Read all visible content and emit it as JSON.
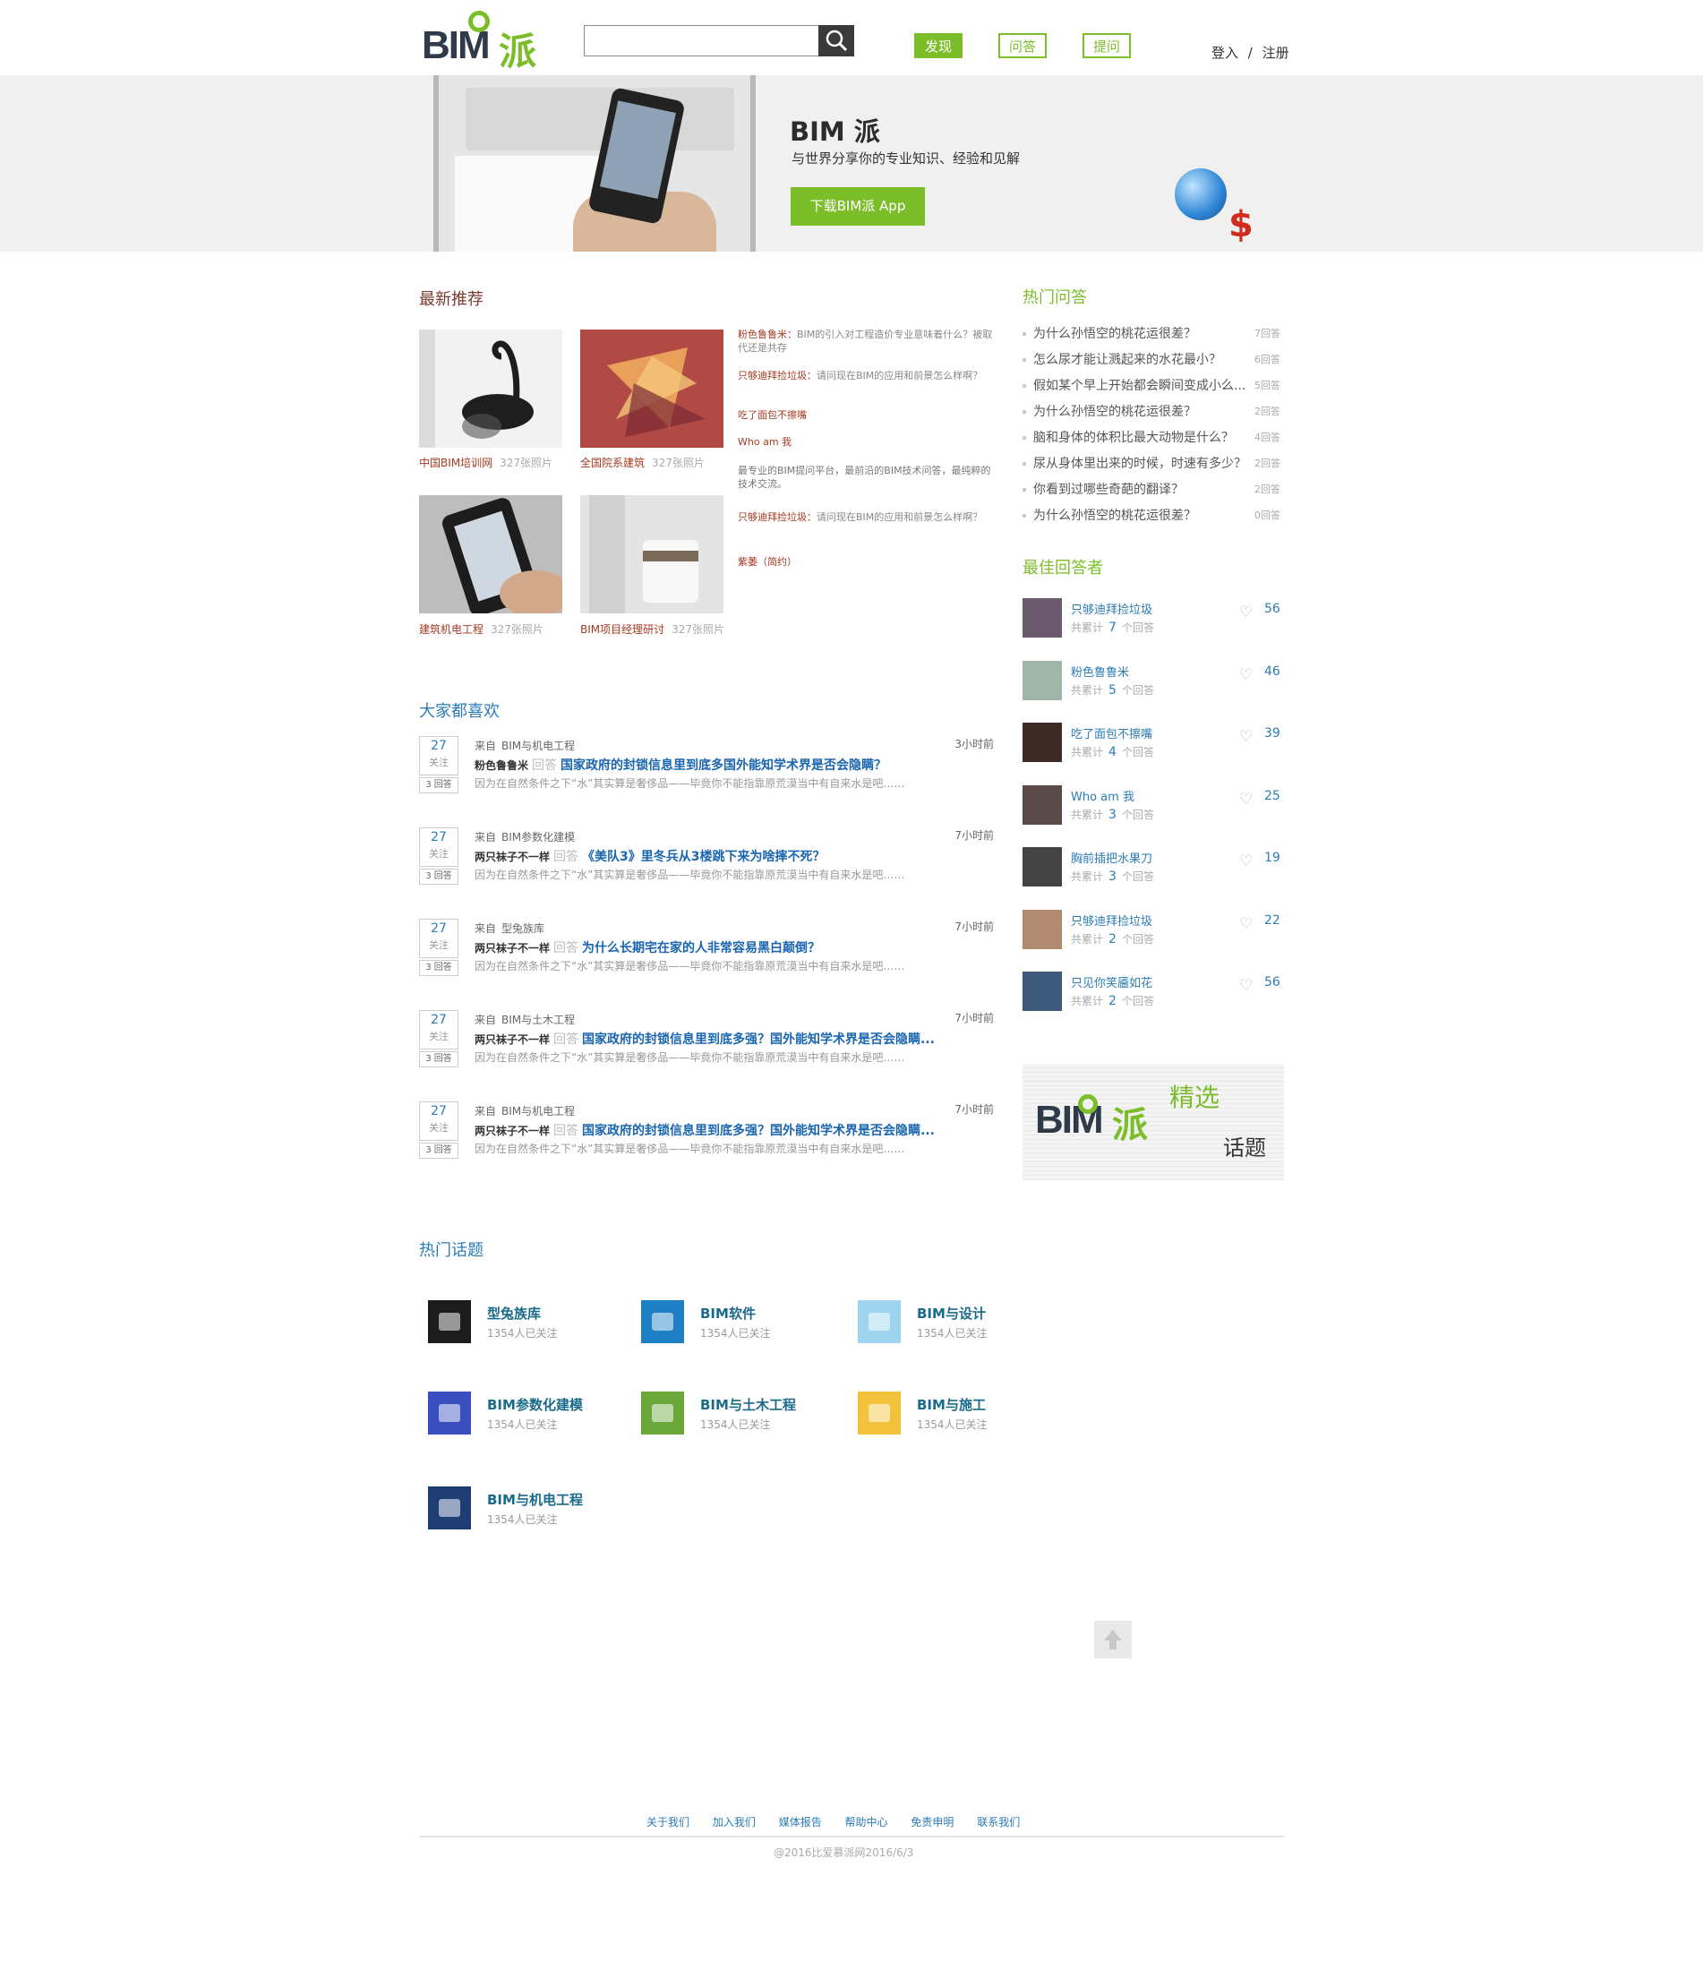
{
  "header": {
    "logo_text": "BIM",
    "logo_cn": "派",
    "search_placeholder": "",
    "nav": [
      "发现",
      "问答",
      "提问"
    ],
    "login": "登入",
    "sep": "/",
    "register": "注册"
  },
  "banner": {
    "title": "BIM 派",
    "subtitle": "与世界分享你的专业知识、经验和见解",
    "download": "下载BIM派 App"
  },
  "recommend": {
    "title": "最新推荐",
    "albums": [
      {
        "name": "中国BIM培训网",
        "count": "327张照片"
      },
      {
        "name": "全国院系建筑",
        "count": "327张照片"
      },
      {
        "name": "建筑机电工程",
        "count": "327张照片"
      },
      {
        "name": "BIM项目经理研讨",
        "count": "327张照片"
      }
    ],
    "items": [
      {
        "user": "粉色鲁鲁米：",
        "text": "BIM的引入对工程造价专业意味着什么？被取代还是共存"
      },
      {
        "user": "只够迪拜捡垃圾：",
        "text": "请问现在BIM的应用和前景怎么样啊？"
      },
      {
        "user": "吃了面包不擦嘴",
        "text": ""
      },
      {
        "user": "Who am 我",
        "text": ""
      },
      {
        "user": "",
        "text": "最专业的BIM提问平台，最前沿的BIM技术问答，最纯粹的技术交流。"
      },
      {
        "user": "只够迪拜捡垃圾：",
        "text": "请问现在BIM的应用和前景怎么样啊？"
      },
      {
        "user": "紫萎（简约）",
        "text": ""
      }
    ]
  },
  "popular": {
    "title": "大家都喜欢",
    "follow_label": "关注",
    "answer_label": "回答",
    "from_label": "来自",
    "items": [
      {
        "follows": "27",
        "answers": "3",
        "source": "BIM与机电工程",
        "time": "3小时前",
        "user": "粉色鲁鲁米",
        "question": "国家政府的封锁信息里到底多国外能知学术界是否会隐瞒？",
        "excerpt": "因为在自然条件之下“水”其实算是奢侈品——毕竟你不能指靠原荒漠当中有自来水是吧……"
      },
      {
        "follows": "27",
        "answers": "3",
        "source": "BIM参数化建模",
        "time": "7小时前",
        "user": "两只袜子不一样",
        "question": "《美队3》里冬兵从3楼跳下来为啥摔不死？",
        "excerpt": "因为在自然条件之下“水”其实算是奢侈品——毕竟你不能指靠原荒漠当中有自来水是吧……"
      },
      {
        "follows": "27",
        "answers": "3",
        "source": "型兔族库",
        "time": "7小时前",
        "user": "两只袜子不一样",
        "question": "为什么长期宅在家的人非常容易黑白颠倒？",
        "excerpt": "因为在自然条件之下“水”其实算是奢侈品——毕竟你不能指靠原荒漠当中有自来水是吧……"
      },
      {
        "follows": "27",
        "answers": "3",
        "source": "BIM与土木工程",
        "time": "7小时前",
        "user": "两只袜子不一样",
        "question": "国家政府的封锁信息里到底多强？国外能知学术界是否会隐瞒...",
        "excerpt": "因为在自然条件之下“水”其实算是奢侈品——毕竟你不能指靠原荒漠当中有自来水是吧……"
      },
      {
        "follows": "27",
        "answers": "3",
        "source": "BIM与机电工程",
        "time": "7小时前",
        "user": "两只袜子不一样",
        "question": "国家政府的封锁信息里到底多强？国外能知学术界是否会隐瞒...",
        "excerpt": "因为在自然条件之下“水”其实算是奢侈品——毕竟你不能指靠原荒漠当中有自来水是吧……"
      }
    ]
  },
  "topics": {
    "title": "热门话题",
    "items": [
      {
        "name": "型兔族库",
        "follow": "1354人已关注",
        "color": "#1c1c1c",
        "icon": "cloud-icon"
      },
      {
        "name": "BIM软件",
        "follow": "1354人已关注",
        "color": "#1e7fc4",
        "icon": "monitor-icon"
      },
      {
        "name": "BIM与设计",
        "follow": "1354人已关注",
        "color": "#9fd4ee",
        "icon": "pencil-icon"
      },
      {
        "name": "BIM参数化建模",
        "follow": "1354人已关注",
        "color": "#3a4ec0",
        "icon": "factory-icon"
      },
      {
        "name": "BIM与土木工程",
        "follow": "1354人已关注",
        "color": "#6aa83c",
        "icon": "trowel-icon"
      },
      {
        "name": "BIM与施工",
        "follow": "1354人已关注",
        "color": "#f2c33a",
        "icon": "cone-icon"
      },
      {
        "name": "BIM与机电工程",
        "follow": "1354人已关注",
        "color": "#1f3c73",
        "icon": "bars-icon"
      }
    ]
  },
  "hot_qa": {
    "title": "热门问答",
    "items": [
      {
        "q": "为什么孙悟空的桃花运很差？",
        "c": "7回答"
      },
      {
        "q": "怎么尿才能让溅起来的水花最小？",
        "c": "6回答"
      },
      {
        "q": "假如某个早上开始都会瞬间变成小么...",
        "c": "5回答"
      },
      {
        "q": "为什么孙悟空的桃花运很差？",
        "c": "2回答"
      },
      {
        "q": "脑和身体的体积比最大动物是什么？",
        "c": "4回答"
      },
      {
        "q": "尿从身体里出来的时候，时速有多少？",
        "c": "2回答"
      },
      {
        "q": "你看到过哪些奇葩的翻译？",
        "c": "2回答"
      },
      {
        "q": "为什么孙悟空的桃花运很差？",
        "c": "0回答"
      }
    ]
  },
  "best": {
    "title": "最佳回答者",
    "total_prefix": "共累计",
    "total_suffix": "个回答",
    "items": [
      {
        "name": "只够迪拜捡垃圾",
        "n": "7",
        "likes": "56",
        "color": "#6b5a6e"
      },
      {
        "name": "粉色鲁鲁米",
        "n": "5",
        "likes": "46",
        "color": "#9fb6a8"
      },
      {
        "name": "吃了面包不擦嘴",
        "n": "4",
        "likes": "39",
        "color": "#3b2a26"
      },
      {
        "name": "Who am 我",
        "n": "3",
        "likes": "25",
        "color": "#5a4a4a"
      },
      {
        "name": "胸前插把水果刀",
        "n": "3",
        "likes": "19",
        "color": "#444"
      },
      {
        "name": "只够迪拜捡垃圾",
        "n": "2",
        "likes": "22",
        "color": "#b08a6e"
      },
      {
        "name": "只见你笑靥如花",
        "n": "2",
        "likes": "56",
        "color": "#3d5a7a"
      }
    ]
  },
  "featured": {
    "t1": "精选",
    "t2": "话题"
  },
  "footer": {
    "links": [
      "关于我们",
      "加入我们",
      "媒体报告",
      "帮助中心",
      "免责申明",
      "联系我们"
    ],
    "copyright": "@2016比爱慕派网2016/6/3"
  }
}
